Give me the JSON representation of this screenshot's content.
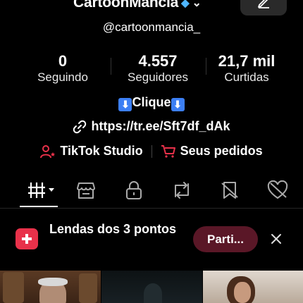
{
  "profile": {
    "username": "CartoonMancia",
    "handle": "@cartoonmancia_",
    "bio_line": "Clique",
    "link": "https://tr.ee/Sft7df_dAk"
  },
  "stats": [
    {
      "value": "0",
      "label": "Seguindo"
    },
    {
      "value": "4.557",
      "label": "Seguidores"
    },
    {
      "value": "21,7 mil",
      "label": "Curtidas"
    }
  ],
  "shortcuts": {
    "studio": "TikTok Studio",
    "orders": "Seus pedidos"
  },
  "tabs": [
    {
      "icon": "grid-icon",
      "active": true
    },
    {
      "icon": "shop-icon"
    },
    {
      "icon": "lock-icon"
    },
    {
      "icon": "repost-icon"
    },
    {
      "icon": "saved-icon"
    },
    {
      "icon": "liked-icon"
    }
  ],
  "banner": {
    "text": "Lendas dos 3 pontos",
    "button": "Parti..."
  },
  "colors": {
    "accent": "#e8314a",
    "button_bg": "#5a1727",
    "verified": "#4fb6ff"
  }
}
